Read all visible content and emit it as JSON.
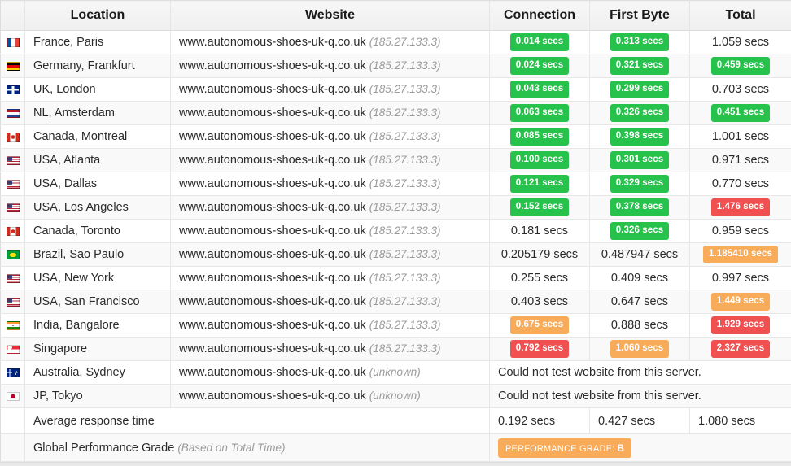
{
  "table": {
    "headers": {
      "flag": "",
      "location": "Location",
      "website": "Website",
      "connection": "Connection",
      "first_byte": "First Byte",
      "total": "Total"
    },
    "error_message": "Could not test website from this server.",
    "rows": [
      {
        "flag": "flag-france-icon",
        "location": "France, Paris",
        "website": "www.autonomous-shoes-uk-q.co.uk",
        "ip": "(185.27.133.3)",
        "connection": "0.014 secs",
        "connection_style": "green",
        "first_byte": "0.313 secs",
        "first_byte_style": "green",
        "total": "1.059 secs",
        "total_style": "plain"
      },
      {
        "flag": "flag-germany-icon",
        "location": "Germany, Frankfurt",
        "website": "www.autonomous-shoes-uk-q.co.uk",
        "ip": "(185.27.133.3)",
        "connection": "0.024 secs",
        "connection_style": "green",
        "first_byte": "0.321 secs",
        "first_byte_style": "green",
        "total": "0.459 secs",
        "total_style": "green"
      },
      {
        "flag": "flag-uk-icon",
        "location": "UK, London",
        "website": "www.autonomous-shoes-uk-q.co.uk",
        "ip": "(185.27.133.3)",
        "connection": "0.043 secs",
        "connection_style": "green",
        "first_byte": "0.299 secs",
        "first_byte_style": "green",
        "total": "0.703 secs",
        "total_style": "plain"
      },
      {
        "flag": "flag-netherlands-icon",
        "location": "NL, Amsterdam",
        "website": "www.autonomous-shoes-uk-q.co.uk",
        "ip": "(185.27.133.3)",
        "connection": "0.063 secs",
        "connection_style": "green",
        "first_byte": "0.326 secs",
        "first_byte_style": "green",
        "total": "0.451 secs",
        "total_style": "green"
      },
      {
        "flag": "flag-canada-icon",
        "location": "Canada, Montreal",
        "website": "www.autonomous-shoes-uk-q.co.uk",
        "ip": "(185.27.133.3)",
        "connection": "0.085 secs",
        "connection_style": "green",
        "first_byte": "0.398 secs",
        "first_byte_style": "green",
        "total": "1.001 secs",
        "total_style": "plain"
      },
      {
        "flag": "flag-usa-icon",
        "location": "USA, Atlanta",
        "website": "www.autonomous-shoes-uk-q.co.uk",
        "ip": "(185.27.133.3)",
        "connection": "0.100 secs",
        "connection_style": "green",
        "first_byte": "0.301 secs",
        "first_byte_style": "green",
        "total": "0.971 secs",
        "total_style": "plain"
      },
      {
        "flag": "flag-usa-icon",
        "location": "USA, Dallas",
        "website": "www.autonomous-shoes-uk-q.co.uk",
        "ip": "(185.27.133.3)",
        "connection": "0.121 secs",
        "connection_style": "green",
        "first_byte": "0.329 secs",
        "first_byte_style": "green",
        "total": "0.770 secs",
        "total_style": "plain"
      },
      {
        "flag": "flag-usa-icon",
        "location": "USA, Los Angeles",
        "website": "www.autonomous-shoes-uk-q.co.uk",
        "ip": "(185.27.133.3)",
        "connection": "0.152 secs",
        "connection_style": "green",
        "first_byte": "0.378 secs",
        "first_byte_style": "green",
        "total": "1.476 secs",
        "total_style": "red"
      },
      {
        "flag": "flag-canada-icon",
        "location": "Canada, Toronto",
        "website": "www.autonomous-shoes-uk-q.co.uk",
        "ip": "(185.27.133.3)",
        "connection": "0.181 secs",
        "connection_style": "plain",
        "first_byte": "0.326 secs",
        "first_byte_style": "green",
        "total": "0.959 secs",
        "total_style": "plain"
      },
      {
        "flag": "flag-brazil-icon",
        "location": "Brazil, Sao Paulo",
        "website": "www.autonomous-shoes-uk-q.co.uk",
        "ip": "(185.27.133.3)",
        "connection": "0.205179 secs",
        "connection_style": "plain",
        "first_byte": "0.487947 secs",
        "first_byte_style": "plain",
        "total": "1.185410 secs",
        "total_style": "orange"
      },
      {
        "flag": "flag-usa-icon",
        "location": "USA, New York",
        "website": "www.autonomous-shoes-uk-q.co.uk",
        "ip": "(185.27.133.3)",
        "connection": "0.255 secs",
        "connection_style": "plain",
        "first_byte": "0.409 secs",
        "first_byte_style": "plain",
        "total": "0.997 secs",
        "total_style": "plain"
      },
      {
        "flag": "flag-usa-icon",
        "location": "USA, San Francisco",
        "website": "www.autonomous-shoes-uk-q.co.uk",
        "ip": "(185.27.133.3)",
        "connection": "0.403 secs",
        "connection_style": "plain",
        "first_byte": "0.647 secs",
        "first_byte_style": "plain",
        "total": "1.449 secs",
        "total_style": "orange"
      },
      {
        "flag": "flag-india-icon",
        "location": "India, Bangalore",
        "website": "www.autonomous-shoes-uk-q.co.uk",
        "ip": "(185.27.133.3)",
        "connection": "0.675 secs",
        "connection_style": "orange",
        "first_byte": "0.888 secs",
        "first_byte_style": "plain",
        "total": "1.929 secs",
        "total_style": "red"
      },
      {
        "flag": "flag-singapore-icon",
        "location": "Singapore",
        "website": "www.autonomous-shoes-uk-q.co.uk",
        "ip": "(185.27.133.3)",
        "connection": "0.792 secs",
        "connection_style": "red",
        "first_byte": "1.060 secs",
        "first_byte_style": "orange",
        "total": "2.327 secs",
        "total_style": "red"
      },
      {
        "flag": "flag-australia-icon",
        "location": "Australia, Sydney",
        "website": "www.autonomous-shoes-uk-q.co.uk",
        "ip": "(unknown)",
        "error": "Could not test website from this server."
      },
      {
        "flag": "flag-japan-icon",
        "location": "JP, Tokyo",
        "website": "www.autonomous-shoes-uk-q.co.uk",
        "ip": "(unknown)",
        "error": "Could not test website from this server."
      }
    ],
    "summary": {
      "average_label": "Average response time",
      "average_connection": "0.192 secs",
      "average_first_byte": "0.427 secs",
      "average_total": "1.080 secs",
      "grade_label": "Global Performance Grade",
      "grade_sub": "(Based on Total Time)",
      "grade_badge_prefix": "PERFORMANCE GRADE:",
      "grade_badge_value": "B"
    }
  },
  "colors": {
    "green": "#27c24c",
    "orange": "#f8ac59",
    "red": "#f05050",
    "header_bg": "#f2f2f2",
    "row_alt": "#f9f9f9",
    "border": "#e7e7e7"
  }
}
